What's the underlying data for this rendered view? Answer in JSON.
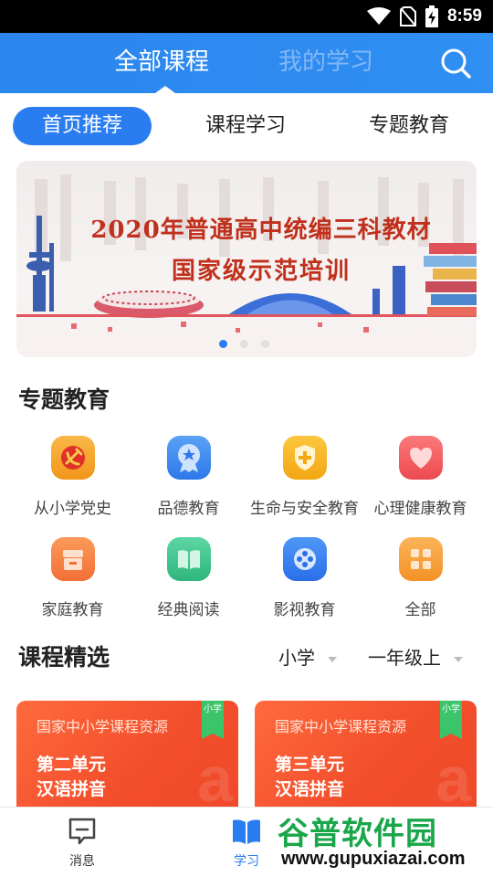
{
  "status_bar": {
    "time": "8:59",
    "icons": [
      "wifi-icon",
      "no-sim-icon",
      "battery-charging-icon"
    ]
  },
  "header": {
    "tabs": [
      {
        "label": "全部课程",
        "active": true
      },
      {
        "label": "我的学习",
        "active": false
      }
    ],
    "search_icon": "search-icon",
    "colors": {
      "background": "#2b86ee",
      "active_text": "#ffffff",
      "inactive_text": "#84b7f4"
    }
  },
  "category_tabs": [
    {
      "label": "首页推荐",
      "active": true
    },
    {
      "label": "课程学习",
      "active": false
    },
    {
      "label": "专题教育",
      "active": false
    }
  ],
  "banner": {
    "line1": "2020年普通高中统编三科教材",
    "line2": "国家级示范培训",
    "pages": 3,
    "current_page": 1
  },
  "special_education": {
    "title": "专题教育",
    "items": [
      {
        "label": "从小学党史",
        "icon": "party-emblem-icon",
        "color": "#f5a623"
      },
      {
        "label": "品德教育",
        "icon": "medal-icon",
        "color": "#3a8bf0"
      },
      {
        "label": "生命与安全教育",
        "icon": "shield-plus-icon",
        "color": "#f7b521"
      },
      {
        "label": "心理健康教育",
        "icon": "heart-icon",
        "color": "#f05a5a"
      },
      {
        "label": "家庭教育",
        "icon": "home-box-icon",
        "color": "#f7864a"
      },
      {
        "label": "经典阅读",
        "icon": "open-book-icon",
        "color": "#3cc48f"
      },
      {
        "label": "影视教育",
        "icon": "film-reel-icon",
        "color": "#3a7ff0"
      },
      {
        "label": "全部",
        "icon": "grid-apps-icon",
        "color": "#f7a23a"
      }
    ]
  },
  "course_selection": {
    "title": "课程精选",
    "filters": [
      {
        "label": "小学"
      },
      {
        "label": "一年级上"
      }
    ],
    "cards": [
      {
        "source": "国家中小学课程资源",
        "unit": "第二单元",
        "topic": "汉语拼音",
        "tag": "小学"
      },
      {
        "source": "国家中小学课程资源",
        "unit": "第三单元",
        "topic": "汉语拼音",
        "tag": "小学"
      }
    ]
  },
  "bottom_nav": [
    {
      "label": "消息",
      "icon": "message-icon",
      "active": false
    },
    {
      "label": "学习",
      "icon": "book-icon",
      "active": true
    }
  ],
  "watermark": {
    "text": "谷普软件园",
    "url": "www.gupuxiazai.com"
  }
}
